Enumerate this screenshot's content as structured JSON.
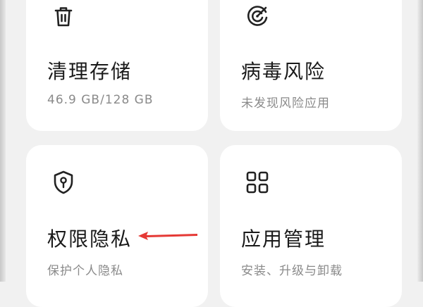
{
  "cards": [
    {
      "icon": "trash-icon",
      "title": "清理存储",
      "subtitle": "46.9 GB/128 GB"
    },
    {
      "icon": "virus-scan-icon",
      "title": "病毒风险",
      "subtitle": "未发现风险应用"
    },
    {
      "icon": "privacy-shield-icon",
      "title": "权限隐私",
      "subtitle": "保护个人隐私"
    },
    {
      "icon": "app-grid-icon",
      "title": "应用管理",
      "subtitle": "安装、升级与卸载"
    }
  ],
  "colors": {
    "background": "#f1f1f1",
    "card": "#ffffff",
    "title_text": "#1a1a1a",
    "subtitle_text": "#8a8a8a",
    "icon_stroke": "#222222",
    "annotation_arrow": "#e53935"
  }
}
